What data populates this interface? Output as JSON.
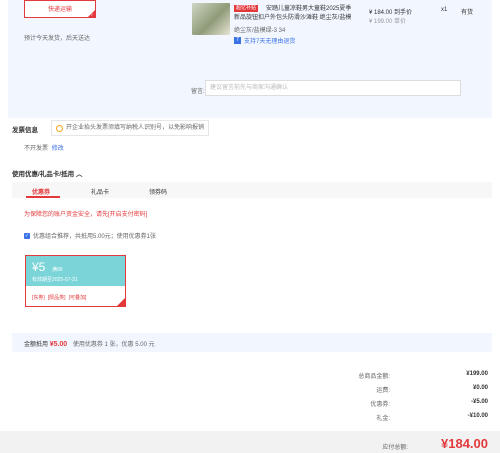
{
  "shipping": {
    "method_label": "快递运输",
    "note": "预计今天发货，后天送达"
  },
  "product": {
    "badge": "超亿补贴",
    "title": "安踏儿童凉鞋男大童鞋2025夏季新品旋钮扣户外包头防滑沙滩鞋 绝尘灰/盐模",
    "spec": "绝尘灰/盐模绿-3 34",
    "service": "支持7天无理由退货",
    "service_icon": "seven-day-return-icon",
    "price": "¥ 184.00 到手价",
    "price_sub": "¥ 199.00 单价",
    "qty": "x1",
    "stock": "有货"
  },
  "remark": {
    "label": "留言:",
    "placeholder": "建议留言前先与商家沟通确认"
  },
  "invoice": {
    "title": "发票信息",
    "tip": "开企业抬头发票须填写纳税人识别号，以免影响报销",
    "status": "不开发票",
    "edit": "修改"
  },
  "coupons": {
    "title": "使用优惠/礼品卡/抵用",
    "tabs": [
      "优惠券",
      "礼品卡",
      "领券码"
    ],
    "security_warning": "为保障您的账户资金安全，请先",
    "security_link": "[开启支付密码]",
    "combo_text": "优惠组合推荐，共抵用5.00元；使用优惠券1张",
    "card": {
      "amount": "¥5",
      "condition": "满99",
      "valid": "有效期至2025-07-31",
      "tags": [
        "[东券]",
        "[限品类]",
        "[可叠加]"
      ]
    },
    "summary_label": "金额抵用",
    "summary_amount": "¥5.00",
    "summary_detail": "使用优惠券 1 张，优惠 5.00 元"
  },
  "totals": {
    "rows": [
      {
        "label": "总商品金额:",
        "value": "¥199.00"
      },
      {
        "label": "运费:",
        "value": "¥0.00"
      },
      {
        "label": "优惠券:",
        "value": "-¥5.00"
      },
      {
        "label": "礼金:",
        "value": "-¥10.00"
      }
    ],
    "payable_label": "应付总额:",
    "payable_value": "¥184.00"
  },
  "colors": {
    "accent": "#e4393c",
    "link": "#3a72e8",
    "block_bg": "#f2f7ff",
    "coupon": "#7ad4d8"
  }
}
